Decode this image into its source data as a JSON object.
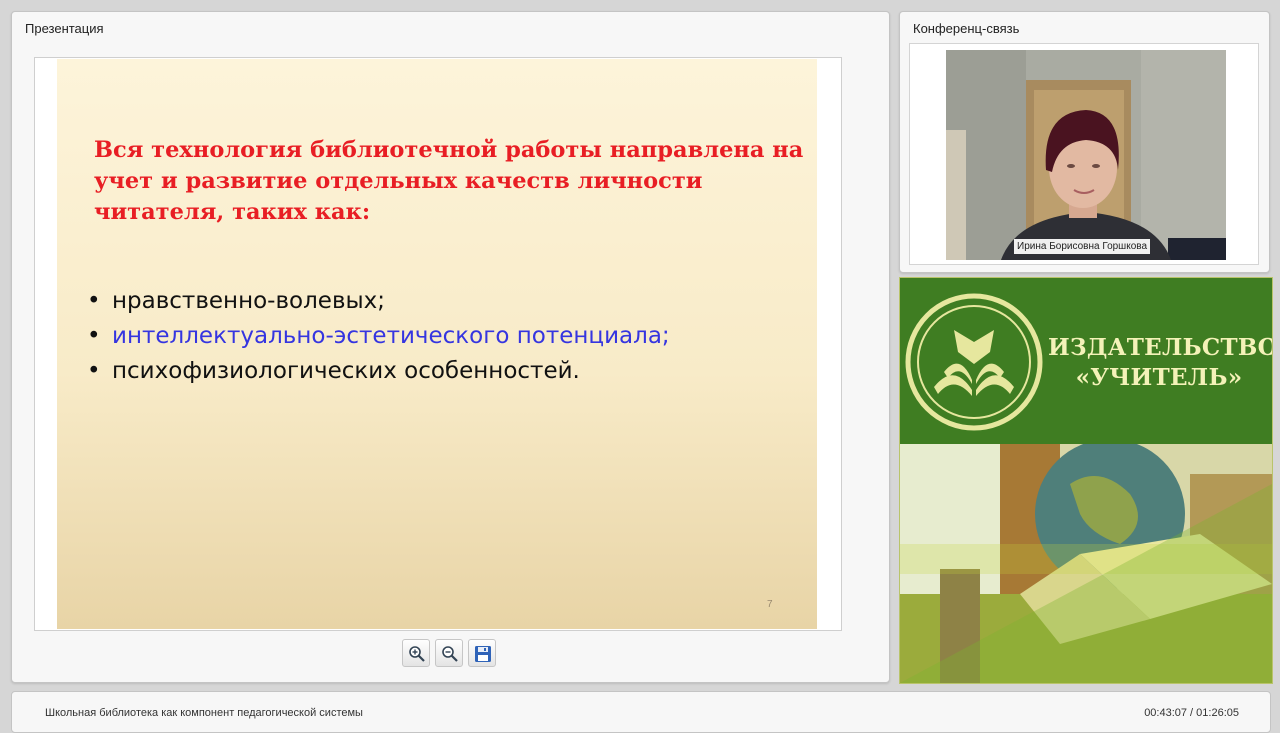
{
  "presentation": {
    "panel_title": "Презентация",
    "slide": {
      "heading": "Вся технология библиотечной работы направлена на учет и развитие отдельных качеств личности читателя, таких как:",
      "bullets": [
        "нравственно-волевых;",
        "интеллектуально-эстетического потенциала;",
        "психофизиологических особенностей."
      ],
      "slide_number": "7",
      "colors": {
        "heading": "#e81e24",
        "bullet_highlight": "#3535e0",
        "bullet_text": "#111111"
      }
    },
    "toolbar": [
      {
        "name": "zoom-in",
        "icon": "zoom-in-icon"
      },
      {
        "name": "zoom-out",
        "icon": "zoom-out-icon"
      },
      {
        "name": "save",
        "icon": "floppy-disk-icon"
      }
    ]
  },
  "conference": {
    "panel_title": "Конференц-связь",
    "participant_name": "Ирина Борисовна Горшкова"
  },
  "banner": {
    "line1": "ИЗДАТЕЛЬСТВО",
    "line2": "«УЧИТЕЛЬ»",
    "colors": {
      "background": "#3f7d22",
      "text": "#f4f2b8"
    }
  },
  "footer": {
    "lecture_title": "Школьная библиотека как компонент педагогической системы",
    "time": "00:43:07 / 01:26:05"
  }
}
